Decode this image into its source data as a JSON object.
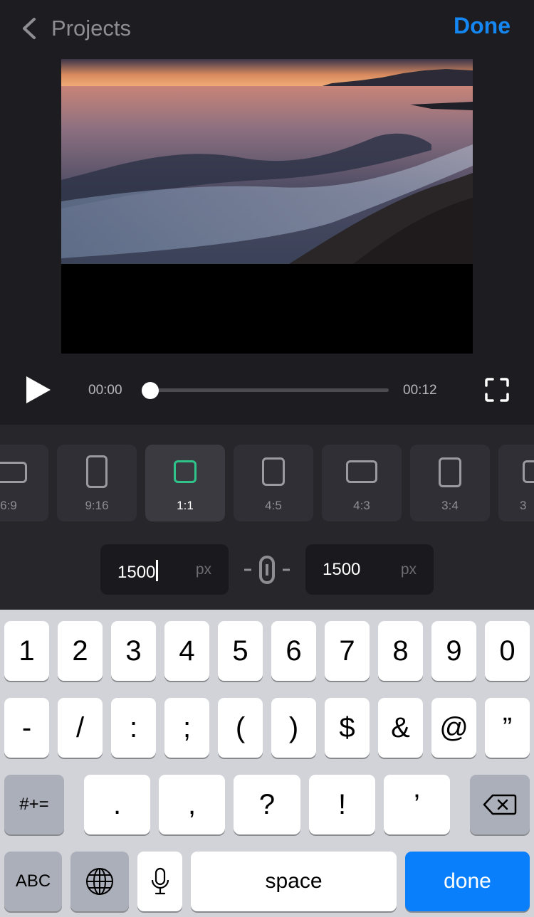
{
  "header": {
    "back_label": "Projects",
    "done_label": "Done"
  },
  "player": {
    "time_start": "00:00",
    "time_end": "00:12",
    "progress": 0.0
  },
  "ratios": [
    {
      "label": "6:9"
    },
    {
      "label": "9:16"
    },
    {
      "label": "1:1",
      "selected": true
    },
    {
      "label": "4:5"
    },
    {
      "label": "4:3"
    },
    {
      "label": "3:4"
    },
    {
      "label": "3"
    }
  ],
  "dimensions": {
    "width_value": "1500",
    "width_unit": "px",
    "height_value": "1500",
    "height_unit": "px"
  },
  "keyboard": {
    "row1": [
      "1",
      "2",
      "3",
      "4",
      "5",
      "6",
      "7",
      "8",
      "9",
      "0"
    ],
    "row2": [
      "-",
      "/",
      ":",
      ";",
      "(",
      ")",
      "$",
      "&",
      "@",
      "”"
    ],
    "row3": {
      "symbols_key": "#+=",
      "keys": [
        ".",
        ",",
        "?",
        "!",
        "’"
      ]
    },
    "row4": {
      "abc": "ABC",
      "space": "space",
      "done": "done"
    }
  },
  "colors": {
    "accent": "#1587f2",
    "selected_ratio": "#2fc58a",
    "keyboard_done": "#0a7ffb"
  },
  "icons": [
    "chevron-left-icon",
    "play-icon",
    "fullscreen-icon",
    "link-icon",
    "globe-icon",
    "microphone-icon",
    "backspace-icon"
  ]
}
